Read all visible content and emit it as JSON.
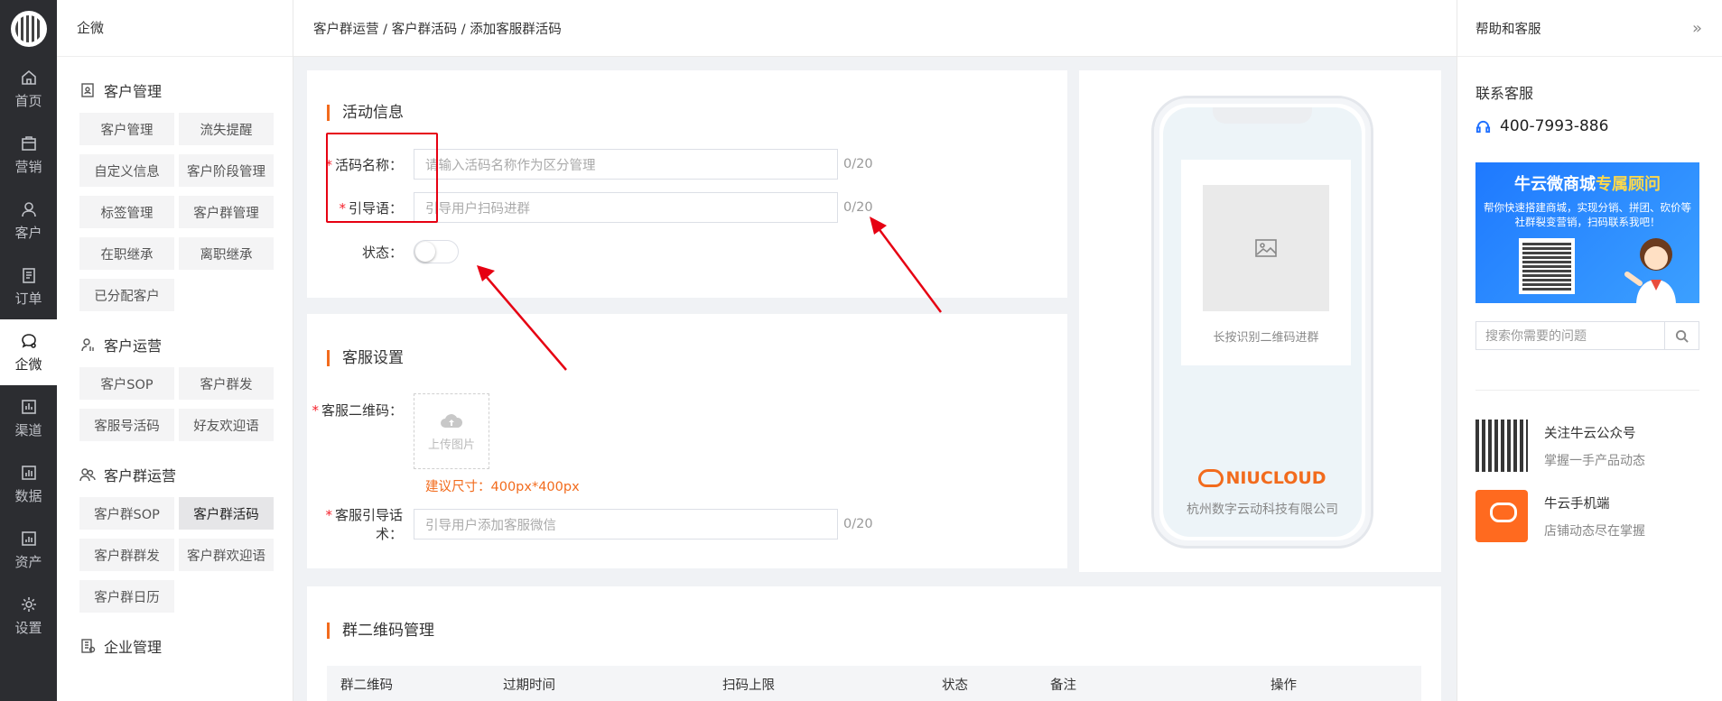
{
  "rail": {
    "items": [
      {
        "label": "首页",
        "icon": "home-icon"
      },
      {
        "label": "营销",
        "icon": "shop-icon"
      },
      {
        "label": "客户",
        "icon": "user-icon"
      },
      {
        "label": "订单",
        "icon": "order-icon"
      },
      {
        "label": "企微",
        "icon": "chat-icon",
        "active": true
      },
      {
        "label": "渠道",
        "icon": "chart-icon"
      },
      {
        "label": "数据",
        "icon": "bar-icon"
      },
      {
        "label": "资产",
        "icon": "asset-icon"
      },
      {
        "label": "设置",
        "icon": "gear-icon"
      }
    ]
  },
  "subnav": {
    "header": "企微",
    "groups": [
      {
        "title": "客户管理",
        "items": [
          "客户管理",
          "流失提醒",
          "自定义信息",
          "客户阶段管理",
          "标签管理",
          "客户群管理",
          "在职继承",
          "离职继承",
          "已分配客户"
        ]
      },
      {
        "title": "客户运营",
        "items": [
          "客户SOP",
          "客户群发",
          "客服号活码",
          "好友欢迎语"
        ]
      },
      {
        "title": "客户群运营",
        "items": [
          "客户群SOP",
          "客户群活码",
          "客户群群发",
          "客户群欢迎语",
          "客户群日历"
        ],
        "active": "客户群活码"
      },
      {
        "title": "企业管理",
        "items": []
      }
    ]
  },
  "breadcrumb": "客户群运营 / 客户群活码 / 添加客服群活码",
  "activity": {
    "title": "活动信息",
    "name_label": "活码名称：",
    "name_placeholder": "请输入活码名称作为区分管理",
    "name_counter": "0/20",
    "guide_label": "引导语：",
    "guide_placeholder": "引导用户扫码进群",
    "guide_counter": "0/20",
    "status_label": "状态："
  },
  "service": {
    "title": "客服设置",
    "qr_label": "客服二维码：",
    "upload_text": "上传图片",
    "size_hint": "建议尺寸：400px*400px",
    "script_label": "客服引导话术：",
    "script_placeholder": "引导用户添加客服微信",
    "script_counter": "0/20"
  },
  "groupqr": {
    "title": "群二维码管理",
    "columns": [
      "群二维码",
      "过期时间",
      "扫码上限",
      "状态",
      "备注",
      "操作"
    ]
  },
  "preview": {
    "caption": "长按识别二维码进群",
    "brand": "NIUCLOUD",
    "company": "杭州数字云动科技有限公司"
  },
  "help": {
    "header": "帮助和客服",
    "contact_title": "联系客服",
    "phone": "400-7993-886",
    "banner_title_a": "牛云微商城",
    "banner_title_b": "专属顾问",
    "banner_desc": "帮你快速搭建商城，实现分销、拼团、砍价等社群裂变营销，扫码联系我吧！",
    "search_placeholder": "搜索你需要的问题",
    "promos": [
      {
        "title": "关注牛云公众号",
        "sub": "掌握一手产品动态",
        "icon": "qrcode-icon"
      },
      {
        "title": "牛云手机端",
        "sub": "店铺动态尽在掌握",
        "icon": "app-icon"
      }
    ]
  },
  "colors": {
    "accent": "#f26b1d",
    "annotation": "#e60012",
    "rail_bg": "#2c2d31"
  }
}
